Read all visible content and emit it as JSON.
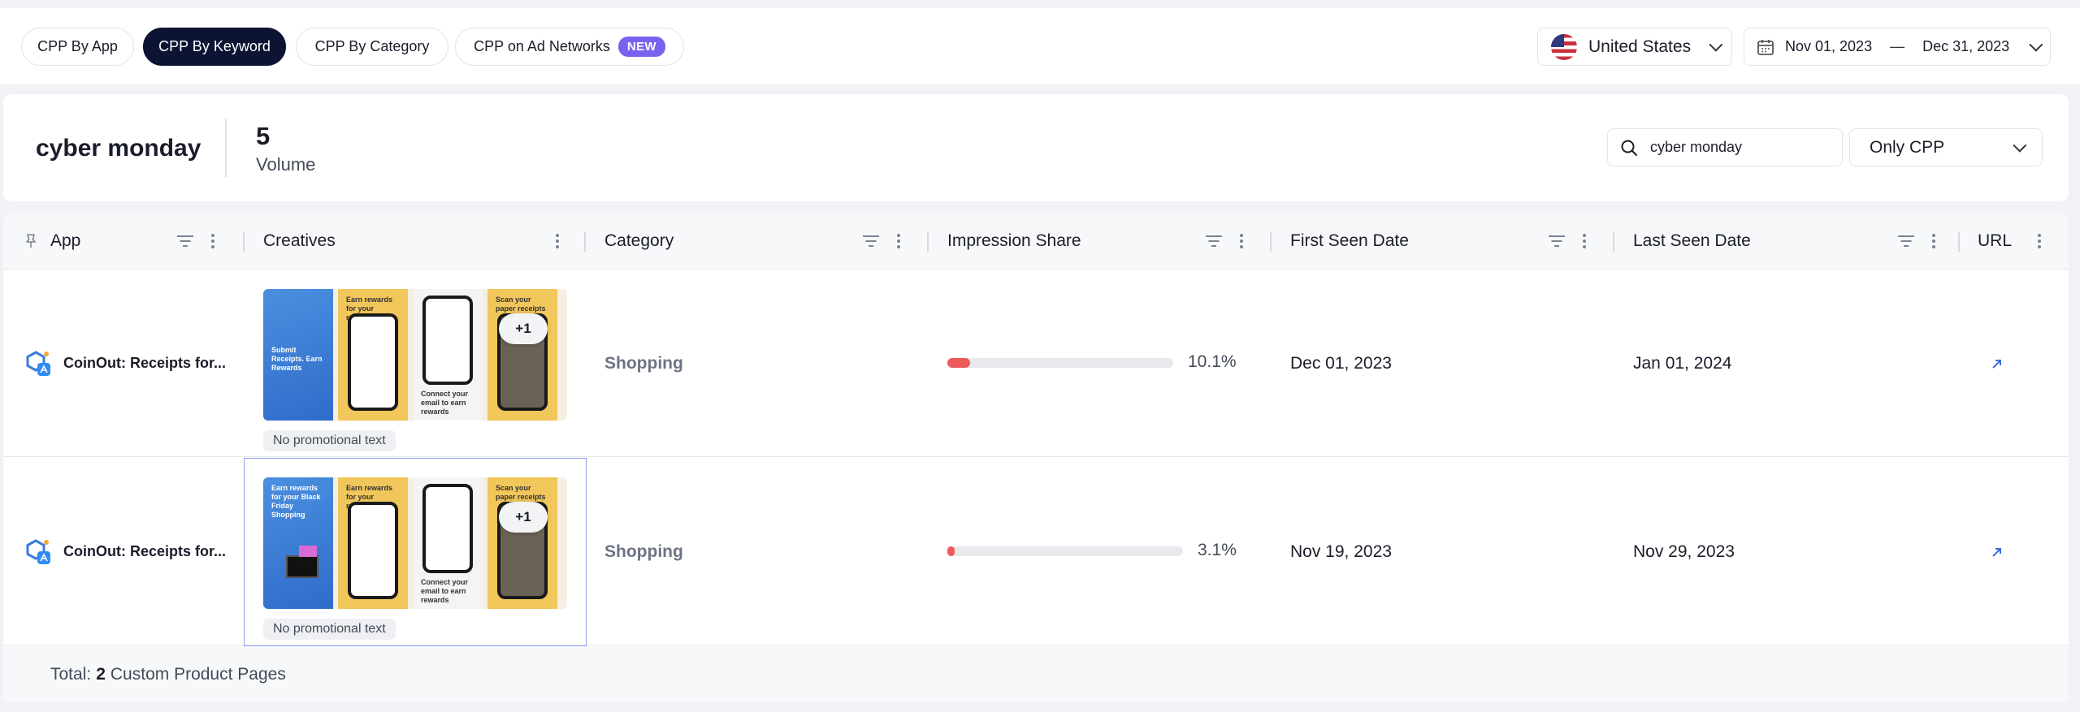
{
  "tabs": [
    {
      "label": "CPP By App",
      "active": false
    },
    {
      "label": "CPP By Keyword",
      "active": true
    },
    {
      "label": "CPP By Category",
      "active": false
    },
    {
      "label": "CPP on Ad Networks",
      "active": false,
      "badge": "NEW"
    }
  ],
  "country": {
    "label": "United States",
    "flag_icon": "us-flag-icon"
  },
  "date_range": {
    "start": "Nov 01, 2023",
    "separator": "—",
    "end": "Dec 31, 2023"
  },
  "keyword": {
    "title": "cyber monday",
    "volume_value": "5",
    "volume_label": "Volume"
  },
  "search": {
    "value": "cyber monday",
    "placeholder": ""
  },
  "filter": {
    "selected": "Only CPP"
  },
  "columns": [
    "App",
    "Creatives",
    "Category",
    "Impression Share",
    "First Seen Date",
    "Last Seen Date",
    "URL"
  ],
  "rows": [
    {
      "app": "CoinOut: Receipts for...",
      "creatives_more": "+1",
      "shot1_text": "Submit Receipts. Earn Rewards",
      "shot2_text": "Earn rewards for your receipts",
      "shot3_text": "Connect your email to earn rewards",
      "shot4_text": "Scan your paper receipts",
      "promo_text": "No promotional text",
      "category": "Shopping",
      "impression_share": 10.1,
      "impression_label": "10.1%",
      "first_seen": "Dec 01, 2023",
      "last_seen": "Jan 01, 2024",
      "url_icon": "external-link-icon"
    },
    {
      "app": "CoinOut: Receipts for...",
      "creatives_more": "+1",
      "shot1_text": "Earn rewards for your Black Friday Shopping",
      "shot2_text": "Earn rewards for your receipts",
      "shot3_text": "Connect your email to earn rewards",
      "shot4_text": "Scan your paper receipts",
      "promo_text": "No promotional text",
      "category": "Shopping",
      "impression_share": 3.1,
      "impression_label": "3.1%",
      "first_seen": "Nov 19, 2023",
      "last_seen": "Nov 29, 2023",
      "url_icon": "external-link-icon"
    }
  ],
  "footer": {
    "prefix": "Total:",
    "count": "2",
    "suffix": "Custom Product Pages"
  },
  "colors": {
    "active_tab": "#0d1433",
    "new_badge": "#7b61f0",
    "bar_fill": "#ec5a5a",
    "link": "#3b6fe0"
  }
}
